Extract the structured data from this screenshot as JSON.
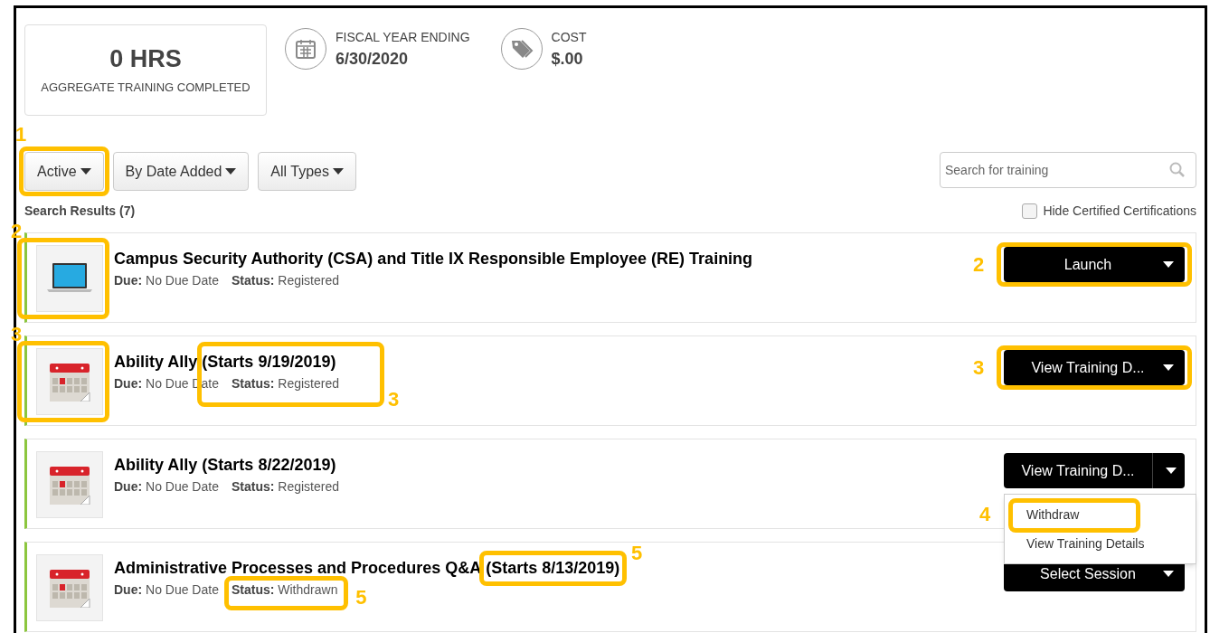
{
  "summary": {
    "hours": "0 HRS",
    "hours_label": "AGGREGATE TRAINING COMPLETED"
  },
  "stats": [
    {
      "kind": "calendar",
      "label": "FISCAL YEAR ENDING",
      "value": "6/30/2020"
    },
    {
      "kind": "tag",
      "label": "COST",
      "value": "$.00"
    }
  ],
  "filters": [
    {
      "label": "Active",
      "callout": "1"
    },
    {
      "label": "By Date Added"
    },
    {
      "label": "All Types"
    }
  ],
  "search": {
    "placeholder": "Search for training"
  },
  "results_label": "Search Results (7)",
  "hide_certified": {
    "label": "Hide Certified Certifications",
    "checked": false
  },
  "rows": [
    {
      "kind": "laptop",
      "icon_callout": "2",
      "title": "Campus Security Authority (CSA) and Title IX Responsible Employee (RE) Training",
      "due_label": "Due:",
      "due": "No Due Date",
      "status_label": "Status:",
      "status": "Registered",
      "action": {
        "label": "Launch",
        "split": false,
        "callout": "2"
      }
    },
    {
      "kind": "calendar",
      "icon_callout": "3",
      "title": "Ability Ally",
      "starts": "(Starts 9/19/2019)",
      "detail_callout": "3",
      "due_label": "Due:",
      "due": "No Due Date",
      "status_label": "Status:",
      "status": "Registered",
      "action": {
        "label": "View Training D...",
        "split": false,
        "callout": "3"
      }
    },
    {
      "kind": "calendar",
      "title": "Ability Ally",
      "starts": "(Starts 8/22/2019)",
      "due_label": "Due:",
      "due": "No Due Date",
      "status_label": "Status:",
      "status": "Registered",
      "action": {
        "label": "View Training D...",
        "split": true
      },
      "menu": [
        {
          "label": "Withdraw",
          "callout": "4"
        },
        {
          "label": "View Training Details"
        }
      ]
    },
    {
      "kind": "calendar",
      "title": "Administrative Processes and Procedures Q&A",
      "starts": "(Starts 8/13/2019)",
      "starts_callout": "5",
      "due_label": "Due:",
      "due": "No Due Date",
      "status_label": "Status:",
      "status": "Withdrawn",
      "status_callout": "5",
      "action": {
        "label": "Select Session",
        "split": false
      }
    }
  ]
}
